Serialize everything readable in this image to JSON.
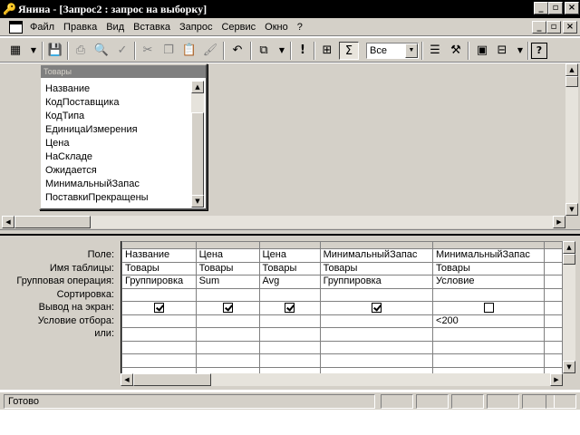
{
  "window": {
    "title": "Янина - [Запрос2 : запрос на выборку]"
  },
  "menu": {
    "items": [
      "Файл",
      "Правка",
      "Вид",
      "Вставка",
      "Запрос",
      "Сервис",
      "Окно",
      "?"
    ]
  },
  "toolbar": {
    "top_values_combo": "Все"
  },
  "field_list": {
    "title": "Товары",
    "fields": [
      "Название",
      "КодПоставщика",
      "КодТипа",
      "ЕдиницаИзмерения",
      "Цена",
      "НаСкладе",
      "Ожидается",
      "МинимальныйЗапас",
      "ПоставкиПрекращены"
    ]
  },
  "qbe": {
    "row_labels": [
      "Поле:",
      "Имя таблицы:",
      "Групповая операция:",
      "Сортировка:",
      "Вывод на экран:",
      "Условие отбора:",
      "или:"
    ],
    "columns": [
      {
        "field": "Название",
        "table": "Товары",
        "total": "Группировка",
        "sort": "",
        "show": true,
        "criteria": "",
        "or": ""
      },
      {
        "field": "Цена",
        "table": "Товары",
        "total": "Sum",
        "sort": "",
        "show": true,
        "criteria": "",
        "or": ""
      },
      {
        "field": "Цена",
        "table": "Товары",
        "total": "Avg",
        "sort": "",
        "show": true,
        "criteria": "",
        "or": ""
      },
      {
        "field": "МинимальныйЗапас",
        "table": "Товары",
        "total": "Группировка",
        "sort": "",
        "show": true,
        "criteria": "",
        "or": ""
      },
      {
        "field": "МинимальныйЗапас",
        "table": "Товары",
        "total": "Условие",
        "sort": "",
        "show": false,
        "criteria": "<200",
        "or": ""
      }
    ]
  },
  "status": {
    "text": "Готово"
  }
}
